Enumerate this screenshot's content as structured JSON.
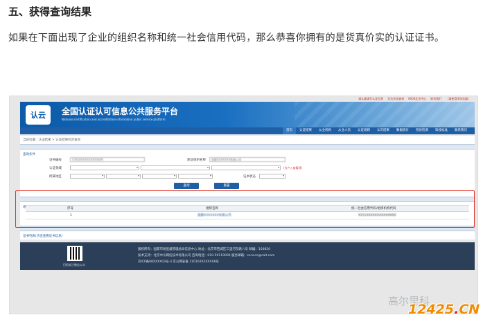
{
  "article": {
    "heading": "五、获得查询结果",
    "paragraph": "如果在下面出现了企业的组织名称和统一社会信用代码，那么恭喜你拥有的是货真价实的认证证书。"
  },
  "site": {
    "topbar_links": [
      "请认真填写认证信息",
      "无法完成查询",
      "8008北京中心",
      "联系我们",
      "（请使用IE浏览器）"
    ],
    "logo_text": "认云",
    "title": "全国认证认可信息公共服务平台",
    "subtitle": "National certification and accreditation information public service platform",
    "nav": [
      "首页",
      "认证结果",
      "从业机构",
      "从业人员",
      "认证规则",
      "认可结果",
      "数据统计",
      "检验检测",
      "科技标准",
      "联系我们"
    ],
    "nav_active_index": 0
  },
  "query": {
    "breadcrumb": "当前位置：认证结果 > 认证结果综合查询",
    "section_title": "查询条件",
    "cert_no_label": "证书编号",
    "cert_no_value": "07818XXXXXXX00S0R",
    "org_name_label": "获证组织名称",
    "org_name_value": "成都XXXXXXX有限公司",
    "field_label": "认证领域",
    "hint": "(为户入查看项)",
    "region_label": "所属地区",
    "status_label": "证书状态",
    "query_button": "查询",
    "reset_button": "重置"
  },
  "results": {
    "section_title": "组织列表(点击查看证书信息)",
    "columns": [
      "序号",
      "组织名称",
      "统一社会信用代码/组织机构代码"
    ],
    "rows": [
      {
        "index": "1",
        "name": "成都XXXXXXX有限公司",
        "code": "9151XXXXXXXXXXX60D"
      }
    ],
    "cert_section_title": "证书列表(点击查看证书信息)"
  },
  "footer": {
    "qr_caption": "扫码关注微信公众",
    "lines": [
      "版权所有：国家市场监督管理总局信息中心    地址：北京市西城区三里河东路八号    邮编：100820",
      "技术支持：北京中认网信技术有限公司  咨询电话：010-59119000  服务邮箱：service@cait.com",
      "京ICP备08XXXX03号-3    京公网安备 11010202XXXX8号"
    ]
  },
  "overlay": {
    "watermark": "高尔里科",
    "stamp_num": "12425",
    "stamp_dot": ".",
    "stamp_cn": "CN"
  }
}
